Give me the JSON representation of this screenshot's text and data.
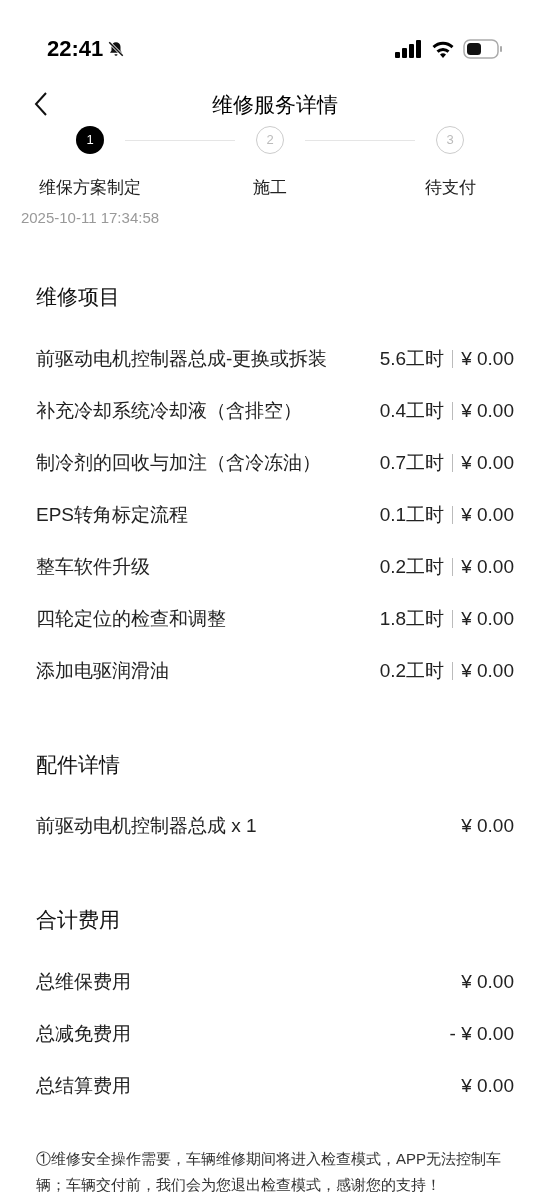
{
  "status_bar": {
    "time": "22:41"
  },
  "header": {
    "title": "维修服务详情"
  },
  "steps": [
    {
      "number": "1",
      "label": "维保方案制定",
      "time": "2025-10-11 17:34:58",
      "selected": true
    },
    {
      "number": "2",
      "label": "施工",
      "selected": false
    },
    {
      "number": "3",
      "label": "待支付",
      "selected": false
    }
  ],
  "repair_items": {
    "title": "维修项目",
    "rows": [
      {
        "name": "前驱动电机控制器总成-更换或拆装",
        "hours": "5.6工时",
        "price": "¥ 0.00"
      },
      {
        "name": "补充冷却系统冷却液（含排空）",
        "hours": "0.4工时",
        "price": "¥ 0.00"
      },
      {
        "name": "制冷剂的回收与加注（含冷冻油）",
        "hours": "0.7工时",
        "price": "¥ 0.00"
      },
      {
        "name": "EPS转角标定流程",
        "hours": "0.1工时",
        "price": "¥ 0.00"
      },
      {
        "name": "整车软件升级",
        "hours": "0.2工时",
        "price": "¥ 0.00"
      },
      {
        "name": "四轮定位的检查和调整",
        "hours": "1.8工时",
        "price": "¥ 0.00"
      },
      {
        "name": "添加电驱润滑油",
        "hours": "0.2工时",
        "price": "¥ 0.00"
      }
    ]
  },
  "parts": {
    "title": "配件详情",
    "rows": [
      {
        "name": "前驱动电机控制器总成 x 1",
        "price": "¥ 0.00"
      }
    ]
  },
  "totals": {
    "title": "合计费用",
    "rows": [
      {
        "name": "总维保费用",
        "price": "¥ 0.00"
      },
      {
        "name": "总减免费用",
        "price": "- ¥ 0.00"
      },
      {
        "name": "总结算费用",
        "price": "¥ 0.00"
      }
    ]
  },
  "note": "①维修安全操作需要，车辆维修期间将进入检查模式，APP无法控制车辆；车辆交付前，我们会为您退出检查模式，感谢您的支持！"
}
